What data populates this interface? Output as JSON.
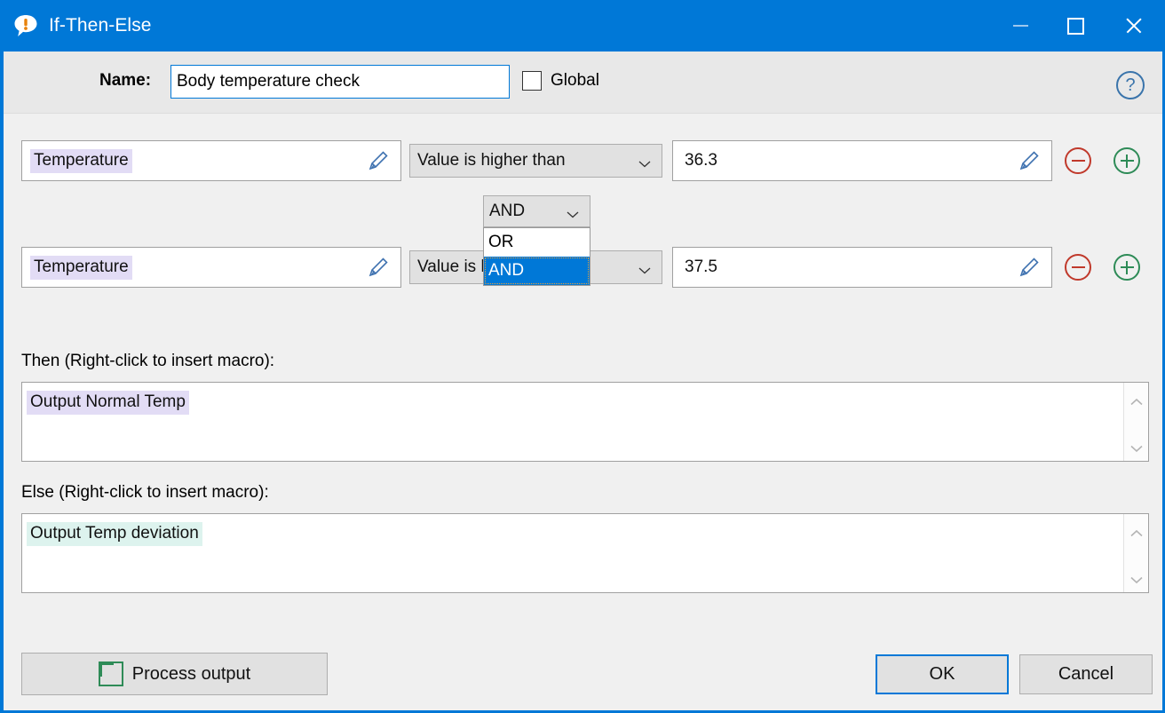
{
  "window": {
    "title": "If-Then-Else",
    "icon": "speech-bubble-exclamation-icon",
    "accent_color": "#0078d7",
    "controls": {
      "minimize": "minimize",
      "maximize": "maximize",
      "close": "close"
    }
  },
  "header": {
    "name_label": "Name:",
    "name_value": "Body temperature check",
    "global_label": "Global",
    "global_checked": false,
    "help_glyph": "?"
  },
  "conditions": [
    {
      "variable": "Temperature",
      "variable_highlight": "#e2dcf5",
      "operator": "Value is higher than",
      "value": "36.3",
      "edit_icon": "pencil-icon",
      "remove_icon": "circle-minus-icon",
      "add_icon": "circle-plus-icon"
    },
    {
      "variable": "Temperature",
      "variable_highlight": "#e2dcf5",
      "operator": "Value is l",
      "value": "37.5",
      "edit_icon": "pencil-icon",
      "remove_icon": "circle-minus-icon",
      "add_icon": "circle-plus-icon"
    }
  ],
  "logic_dropdown": {
    "selected": "AND",
    "expanded": true,
    "options": [
      "OR",
      "AND"
    ],
    "highlighted_option": "AND",
    "highlight_color": "#0078d7"
  },
  "then_section": {
    "label": "Then (Right-click to insert macro):",
    "content": "Output Normal Temp",
    "highlight": "#e2dcf5"
  },
  "else_section": {
    "label": "Else (Right-click to insert macro):",
    "content": "Output Temp deviation",
    "highlight": "#ddf3ee"
  },
  "footer": {
    "process_output_label": "Process output",
    "process_output_icon": "circle-plus-icon",
    "ok_label": "OK",
    "cancel_label": "Cancel"
  }
}
